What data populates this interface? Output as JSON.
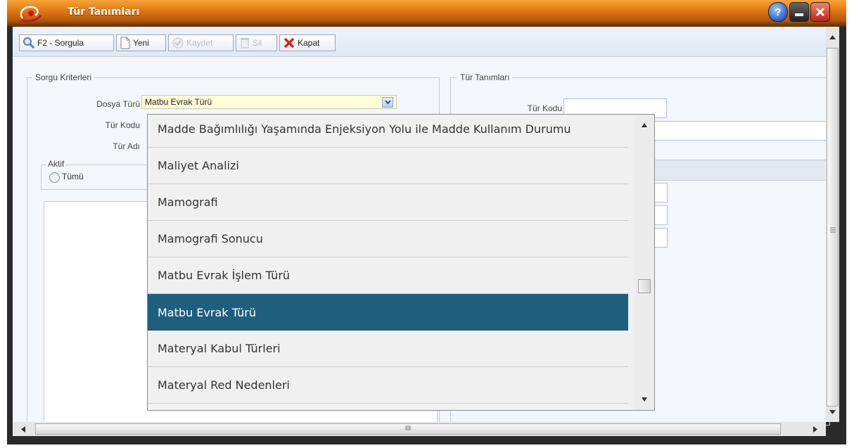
{
  "window": {
    "title": "Tür Tanımları"
  },
  "toolbar": {
    "query_label": "F2 - Sorgula",
    "new_label": "Yeni",
    "save_label": "Kaydet",
    "delete_label": "Sil",
    "close_label": "Kapat"
  },
  "criteria": {
    "legend": "Sorgu Kriterleri",
    "file_type_label": "Dosya Türü",
    "file_type_value": "Matbu Evrak Türü",
    "type_code_label": "Tür Kodu",
    "type_name_label": "Tür Adı",
    "active_legend": "Aktif",
    "all_option": "Tümü"
  },
  "definitions": {
    "legend": "Tür Tanımları",
    "type_code_label": "Tür Kodu"
  },
  "dropdown": {
    "items": [
      "Madde Bağımlılığı Yaşamında Enjeksiyon Yolu ile Madde Kullanım Durumu",
      "Maliyet Analizi",
      "Mamografi",
      "Mamografi Sonucu",
      "Matbu Evrak İşlem Türü",
      "Matbu Evrak Türü",
      "Materyal Kabul Türleri",
      "Materyal Red Nedenleri"
    ],
    "selected_index": 5,
    "selected_color": "#1f5f7e"
  },
  "scroll": {
    "hscroll_grip": "III"
  },
  "colors": {
    "titlebar": "#e07812",
    "accent": "#1f5f7e",
    "select_bg": "#fefdd8"
  }
}
